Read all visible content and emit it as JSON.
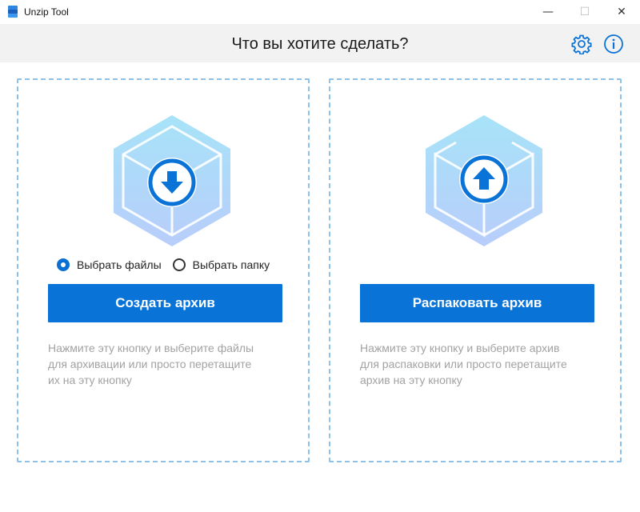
{
  "window": {
    "title": "Unzip Tool",
    "minimize_glyph": "—",
    "maximize_glyph": "☐",
    "close_glyph": "✕"
  },
  "header": {
    "title": "Что вы хотите сделать?",
    "icons": [
      "gear-icon",
      "info-icon"
    ]
  },
  "create_panel": {
    "radio_options": [
      {
        "label": "Выбрать файлы",
        "checked": true
      },
      {
        "label": "Выбрать папку",
        "checked": false
      }
    ],
    "button_label": "Создать архив",
    "hint_lines": [
      "Нажмите эту кнопку и выберите файлы",
      "для архивации или просто перетащите",
      "их на эту кнопку"
    ],
    "icon": "cube-download-icon"
  },
  "extract_panel": {
    "button_label": "Распаковать архив",
    "hint_lines": [
      "Нажмите эту кнопку и выберите архив",
      "для распаковки или просто перетащите",
      "архив на эту кнопку"
    ],
    "icon": "cube-upload-icon"
  },
  "colors": {
    "accent": "#0a73d7",
    "header_bg": "#f2f2f2",
    "dashed_border": "#8cc1ea",
    "hint_text": "#a2a2a2"
  }
}
